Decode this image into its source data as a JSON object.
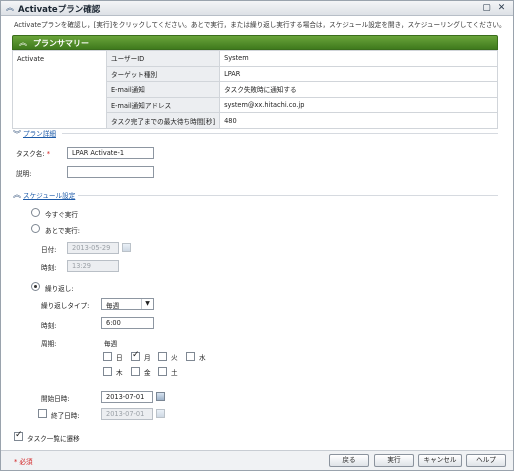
{
  "window": {
    "title": "Activateプラン確認",
    "description": "Activateプランを確認し，[実行]をクリックしてください。あとで実行，または繰り返し実行する場合は，スケジュール設定を開き，スケジューリングしてください。"
  },
  "summary": {
    "heading": "プランサマリー",
    "task": "Activate",
    "rows": [
      {
        "label": "ユーザーID",
        "value": "System"
      },
      {
        "label": "ターゲット種別",
        "value": "LPAR"
      },
      {
        "label": "E-mail通知",
        "value": "タスク失敗時に通知する"
      },
      {
        "label": "E-mail通知アドレス",
        "value": "system@xx.hitachi.co.jp"
      },
      {
        "label": "タスク完了までの最大待ち時間[秒]",
        "value": "480"
      }
    ]
  },
  "plan_details": {
    "link": "プラン詳細",
    "task_name_label": "タスク名:",
    "required_mark": "*",
    "task_name_value": "LPAR Activate-1",
    "description_label": "説明:",
    "description_value": ""
  },
  "schedule": {
    "link": "スケジュール設定",
    "run_now": "今すぐ実行",
    "run_later": "あとで実行:",
    "date_label": "日付:",
    "date_value": "2013-05-29",
    "time_label": "時刻:",
    "time_value": "13:29",
    "repeat": "繰り返し:",
    "repeat_type_label": "繰り返しタイプ:",
    "repeat_type_value": "毎週",
    "repeat_time_label": "時刻:",
    "repeat_time_value": "6:00",
    "period_label": "周期:",
    "period_value": "毎週",
    "days": [
      "日",
      "月",
      "火",
      "水",
      "木",
      "金",
      "土"
    ],
    "days_checked": [
      false,
      true,
      false,
      false,
      false,
      false,
      false
    ],
    "start_date_label": "開始日時:",
    "start_date_value": "2013-07-01",
    "end_date_label": "終了日時:",
    "end_date_value": "2013-07-01",
    "selected": "repeat"
  },
  "goto_tasklist": "タスク一覧に遷移",
  "footer": {
    "required_note": "* 必須",
    "back": "戻る",
    "execute": "実行",
    "cancel": "キャンセル",
    "help": "ヘルプ"
  },
  "colors": {
    "summary_header": "#4f8a27",
    "link": "#1c5aa8",
    "required": "#d11a1a"
  }
}
